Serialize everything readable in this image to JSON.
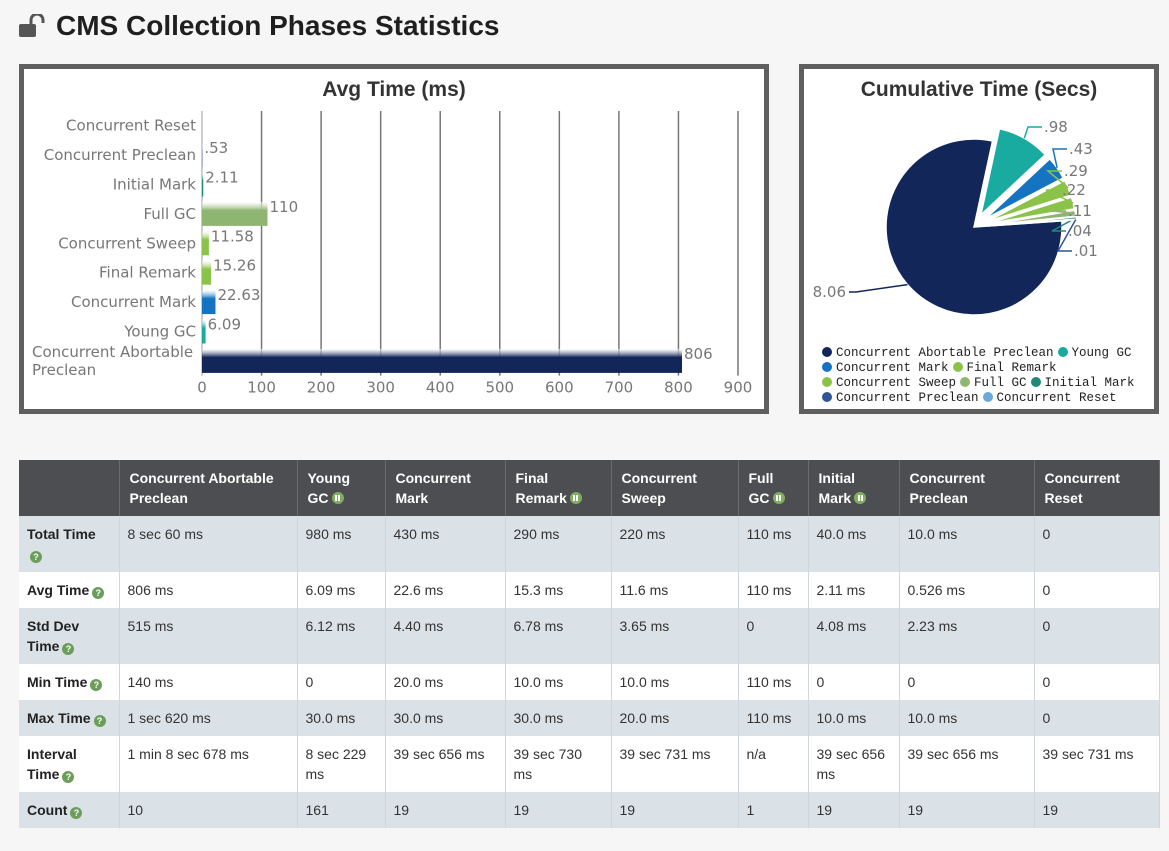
{
  "page": {
    "title": "CMS Collection Phases Statistics"
  },
  "colors": {
    "Concurrent Abortable Preclean": "#12265a",
    "Young GC": "#1aaba0",
    "Concurrent Mark": "#1574c2",
    "Final Remark": "#8bc34a",
    "Concurrent Sweep": "#8bc34a",
    "Full GC": "#8fb573",
    "Initial Mark": "#1e8a74",
    "Concurrent Preclean": "#2f5597",
    "Concurrent Reset": "#6aa8d9"
  },
  "chart_data": [
    {
      "type": "bar",
      "orientation": "horizontal",
      "title": "Avg Time (ms)",
      "categories": [
        "Concurrent Reset",
        "Concurrent Preclean",
        "Initial Mark",
        "Full GC",
        "Concurrent Sweep",
        "Final Remark",
        "Concurrent Mark",
        "Young GC",
        "Concurrent Abortable Preclean"
      ],
      "category_label_lines": [
        [
          "Concurrent Reset"
        ],
        [
          "Concurrent Preclean"
        ],
        [
          "Initial Mark"
        ],
        [
          "Full GC"
        ],
        [
          "Concurrent Sweep"
        ],
        [
          "Final Remark"
        ],
        [
          "Concurrent Mark"
        ],
        [
          "Young GC"
        ],
        [
          "Concurrent Abortable",
          "Preclean"
        ]
      ],
      "values": [
        0,
        0.53,
        2.11,
        110,
        11.58,
        15.26,
        22.63,
        6.09,
        806
      ],
      "value_labels": [
        "",
        ".53",
        "2.11",
        "110",
        "11.58",
        "15.26",
        "22.63",
        "6.09",
        "806"
      ],
      "xlim": [
        0,
        900
      ],
      "xticks": [
        "0",
        "100",
        "200",
        "300",
        "400",
        "500",
        "600",
        "700",
        "800",
        "900"
      ],
      "grid": true
    },
    {
      "type": "pie",
      "title": "Cumulative Time (Secs)",
      "labels": [
        "Concurrent Abortable Preclean",
        "Young GC",
        "Concurrent Mark",
        "Final Remark",
        "Concurrent Sweep",
        "Full GC",
        "Initial Mark",
        "Concurrent Preclean",
        "Concurrent Reset"
      ],
      "values": [
        8.06,
        0.98,
        0.43,
        0.29,
        0.22,
        0.11,
        0.04,
        0.01,
        0
      ],
      "value_labels": [
        "8.06",
        ".98",
        ".43",
        ".29",
        ".22",
        ".11",
        ".04",
        ".01",
        ""
      ],
      "legend": "bottom"
    }
  ],
  "table": {
    "columns": [
      {
        "label": "",
        "icon": ""
      },
      {
        "label": "Concurrent Abortable Preclean",
        "icon": ""
      },
      {
        "label": "Young GC",
        "icon": "pause-icon"
      },
      {
        "label": "Concurrent Mark",
        "icon": ""
      },
      {
        "label": "Final Remark",
        "icon": "pause-icon"
      },
      {
        "label": "Concurrent Sweep",
        "icon": ""
      },
      {
        "label": "Full GC",
        "icon": "pause-icon"
      },
      {
        "label": "Initial Mark",
        "icon": "pause-icon"
      },
      {
        "label": "Concurrent Preclean",
        "icon": ""
      },
      {
        "label": "Concurrent Reset",
        "icon": ""
      }
    ],
    "rows": [
      {
        "label": "Total Time",
        "values": [
          "8 sec 60 ms",
          "980 ms",
          "430 ms",
          "290 ms",
          "220 ms",
          "110 ms",
          "40.0 ms",
          "10.0 ms",
          "0"
        ]
      },
      {
        "label": "Avg Time",
        "values": [
          "806 ms",
          "6.09 ms",
          "22.6 ms",
          "15.3 ms",
          "11.6 ms",
          "110 ms",
          "2.11 ms",
          "0.526 ms",
          "0"
        ]
      },
      {
        "label": "Std Dev Time",
        "values": [
          "515 ms",
          "6.12 ms",
          "4.40 ms",
          "6.78 ms",
          "3.65 ms",
          "0",
          "4.08 ms",
          "2.23 ms",
          "0"
        ]
      },
      {
        "label": "Min Time",
        "values": [
          "140 ms",
          "0",
          "20.0 ms",
          "10.0 ms",
          "10.0 ms",
          "110 ms",
          "0",
          "0",
          "0"
        ]
      },
      {
        "label": "Max Time",
        "values": [
          "1 sec 620 ms",
          "30.0 ms",
          "30.0 ms",
          "30.0 ms",
          "20.0 ms",
          "110 ms",
          "10.0 ms",
          "10.0 ms",
          "0"
        ]
      },
      {
        "label": "Interval Time",
        "values": [
          "1 min 8 sec 678 ms",
          "8 sec 229 ms",
          "39 sec 656 ms",
          "39 sec 730 ms",
          "39 sec 731 ms",
          "n/a",
          "39 sec 656 ms",
          "39 sec 656 ms",
          "39 sec 731 ms"
        ]
      },
      {
        "label": "Count",
        "values": [
          "10",
          "161",
          "19",
          "19",
          "19",
          "1",
          "19",
          "19",
          "19"
        ]
      }
    ]
  }
}
